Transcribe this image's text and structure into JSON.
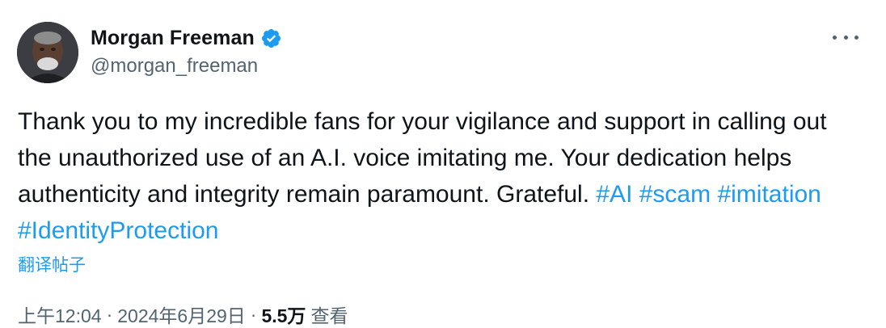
{
  "author": {
    "display_name": "Morgan Freeman",
    "handle": "@morgan_freeman",
    "verified_icon": "verified-badge-icon",
    "avatar_icon": "profile-avatar"
  },
  "more_icon": "more-options-icon",
  "tweet": {
    "text": "Thank you to my incredible fans for your vigilance and support in calling out the unauthorized use of an A.I. voice imitating me. Your dedication helps authenticity and integrity remain paramount. Grateful. ",
    "hashtags": [
      "#AI",
      "#scam",
      "#imitation",
      "#IdentityProtection"
    ]
  },
  "translate_label": "翻译帖子",
  "meta": {
    "time": "上午12:04",
    "separator": "·",
    "date": "2024年6月29日",
    "views_count": "5.5万",
    "views_label": "查看"
  },
  "colors": {
    "link": "#1d9bf0",
    "text": "#0f1419",
    "secondary": "#536471"
  }
}
